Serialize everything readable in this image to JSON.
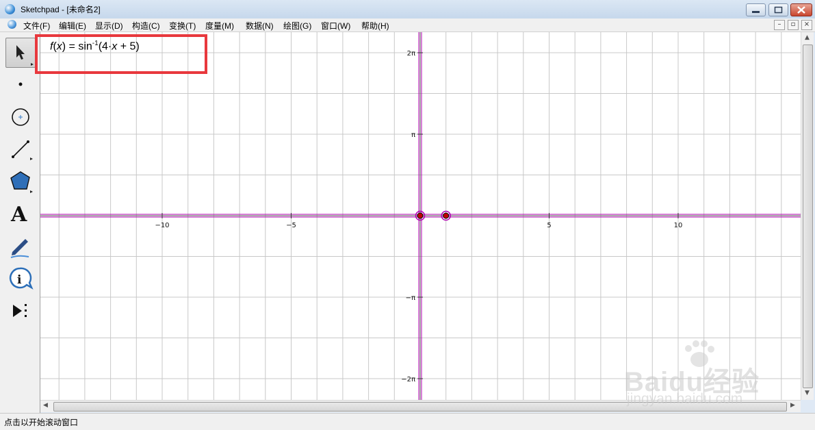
{
  "window": {
    "title": "Sketchpad  - [未命名2]"
  },
  "menu": {
    "items": [
      "文件(F)",
      "编辑(E)",
      "显示(D)",
      "构造(C)",
      "变换(T)",
      "度量(M)",
      "数据(N)",
      "绘图(G)",
      "窗口(W)",
      "帮助(H)"
    ]
  },
  "toolbox": {
    "tools": [
      "arrow-select-tool",
      "point-tool",
      "compass-tool",
      "straightedge-tool",
      "polygon-tool",
      "text-tool",
      "marker-tool",
      "information-tool",
      "custom-tools"
    ]
  },
  "graph": {
    "function_label": {
      "f": "f",
      "x": "x",
      "eq": " = sin",
      "sup": "-1",
      "arg_open": "(4·",
      "arg_x": "x",
      "arg_rest": " + 5)"
    },
    "x_ticks": [
      {
        "value": -10,
        "label": "−10"
      },
      {
        "value": -5,
        "label": "−5"
      },
      {
        "value": 5,
        "label": "5"
      },
      {
        "value": 10,
        "label": "10"
      }
    ],
    "y_ticks": [
      {
        "value": 2,
        "label": "2π"
      },
      {
        "value": 1,
        "label": "π"
      },
      {
        "value": -1,
        "label": "−π"
      },
      {
        "value": -2,
        "label": "−2π"
      }
    ],
    "points": [
      {
        "name": "origin",
        "x": 0,
        "y": 0
      },
      {
        "name": "unit-point",
        "x": 1,
        "y": 0
      }
    ],
    "axis_color": "#b100b1",
    "point_fill": "#c00000"
  },
  "status": {
    "text": "点击以开始滚动窗口"
  },
  "watermark": {
    "text1": "Baidu经验",
    "text2": "jingyan.baidu.com"
  }
}
